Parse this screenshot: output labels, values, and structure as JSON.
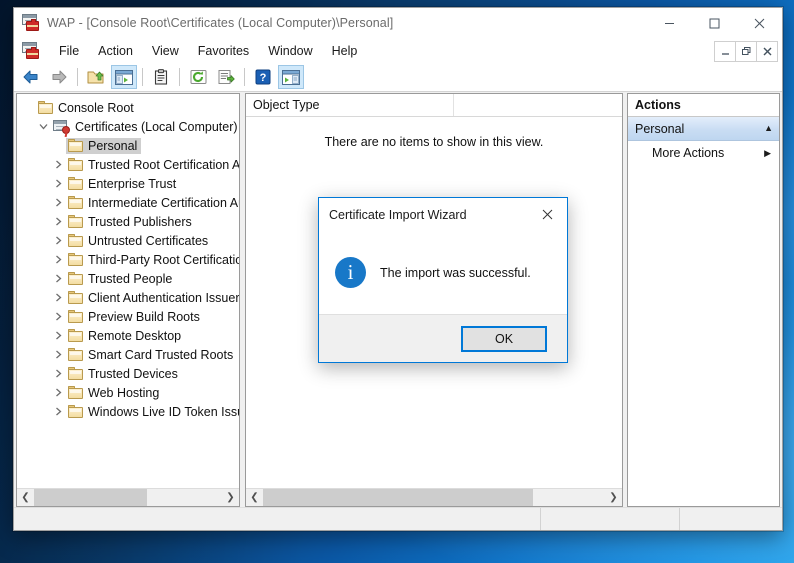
{
  "window": {
    "title": "WAP - [Console Root\\Certificates (Local Computer)\\Personal]",
    "app_icon": "mmc-console-icon",
    "controls": {
      "minimize": "minimize-icon",
      "maximize": "maximize-icon",
      "close": "close-icon"
    },
    "mdi_controls": {
      "minimize": "mdi-minimize-icon",
      "restore": "mdi-restore-icon",
      "close": "mdi-close-icon"
    }
  },
  "menubar": {
    "items": [
      {
        "label": "File"
      },
      {
        "label": "Action"
      },
      {
        "label": "View"
      },
      {
        "label": "Favorites"
      },
      {
        "label": "Window"
      },
      {
        "label": "Help"
      }
    ]
  },
  "toolbar": {
    "buttons": [
      {
        "name": "back-button",
        "icon": "arrow-left-icon",
        "active": false
      },
      {
        "name": "forward-button",
        "icon": "arrow-right-icon",
        "active": false
      },
      {
        "name": "up-one-level-button",
        "icon": "folder-up-icon",
        "active": false
      },
      {
        "name": "show-console-tree-button",
        "icon": "console-tree-icon",
        "active": true
      },
      {
        "name": "properties-button",
        "icon": "clipboard-icon",
        "active": false
      },
      {
        "name": "refresh-button",
        "icon": "refresh-icon",
        "active": false
      },
      {
        "name": "export-list-button",
        "icon": "export-list-icon",
        "active": false
      },
      {
        "name": "help-button",
        "icon": "help-question-icon",
        "active": false
      },
      {
        "name": "show-action-pane-button",
        "icon": "action-pane-icon",
        "active": true
      }
    ]
  },
  "tree": {
    "items": [
      {
        "label": "Console Root",
        "depth": 0,
        "expander": "none",
        "icon": "folder-icon",
        "selected": false
      },
      {
        "label": "Certificates (Local Computer)",
        "depth": 1,
        "expander": "collapse",
        "icon": "snapin-icon",
        "selected": false
      },
      {
        "label": "Personal",
        "depth": 2,
        "expander": "none",
        "icon": "folder-icon",
        "selected": true
      },
      {
        "label": "Trusted Root Certification Au",
        "depth": 2,
        "expander": "expand",
        "icon": "folder-icon",
        "selected": false
      },
      {
        "label": "Enterprise Trust",
        "depth": 2,
        "expander": "expand",
        "icon": "folder-icon",
        "selected": false
      },
      {
        "label": "Intermediate Certification Au",
        "depth": 2,
        "expander": "expand",
        "icon": "folder-icon",
        "selected": false
      },
      {
        "label": "Trusted Publishers",
        "depth": 2,
        "expander": "expand",
        "icon": "folder-icon",
        "selected": false
      },
      {
        "label": "Untrusted Certificates",
        "depth": 2,
        "expander": "expand",
        "icon": "folder-icon",
        "selected": false
      },
      {
        "label": "Third-Party Root Certification",
        "depth": 2,
        "expander": "expand",
        "icon": "folder-icon",
        "selected": false
      },
      {
        "label": "Trusted People",
        "depth": 2,
        "expander": "expand",
        "icon": "folder-icon",
        "selected": false
      },
      {
        "label": "Client Authentication Issuers",
        "depth": 2,
        "expander": "expand",
        "icon": "folder-icon",
        "selected": false
      },
      {
        "label": "Preview Build Roots",
        "depth": 2,
        "expander": "expand",
        "icon": "folder-icon",
        "selected": false
      },
      {
        "label": "Remote Desktop",
        "depth": 2,
        "expander": "expand",
        "icon": "folder-icon",
        "selected": false
      },
      {
        "label": "Smart Card Trusted Roots",
        "depth": 2,
        "expander": "expand",
        "icon": "folder-icon",
        "selected": false
      },
      {
        "label": "Trusted Devices",
        "depth": 2,
        "expander": "expand",
        "icon": "folder-icon",
        "selected": false
      },
      {
        "label": "Web Hosting",
        "depth": 2,
        "expander": "expand",
        "icon": "folder-icon",
        "selected": false
      },
      {
        "label": "Windows Live ID Token Issue",
        "depth": 2,
        "expander": "expand",
        "icon": "folder-icon",
        "selected": false
      }
    ]
  },
  "content": {
    "column_header": "Object Type",
    "empty_message": "There are no items to show in this view."
  },
  "actions": {
    "header": "Actions",
    "group_title": "Personal",
    "group_chevron": "chevron-up-icon",
    "items": [
      {
        "label": "More Actions",
        "arrow": "chevron-right-icon"
      }
    ]
  },
  "statusbar": {
    "main": "",
    "cell2": "",
    "cell3": ""
  },
  "dialog": {
    "title": "Certificate Import Wizard",
    "close_icon": "close-icon",
    "icon": "info-icon",
    "icon_glyph": "i",
    "message": "The import was successful.",
    "ok_label": "OK"
  },
  "colors": {
    "accent": "#0078d7",
    "info_blue": "#1878c8",
    "selection_gray": "#cfcfcf",
    "actions_group": "#c9ddf3",
    "desktop": "#0b57a4"
  }
}
